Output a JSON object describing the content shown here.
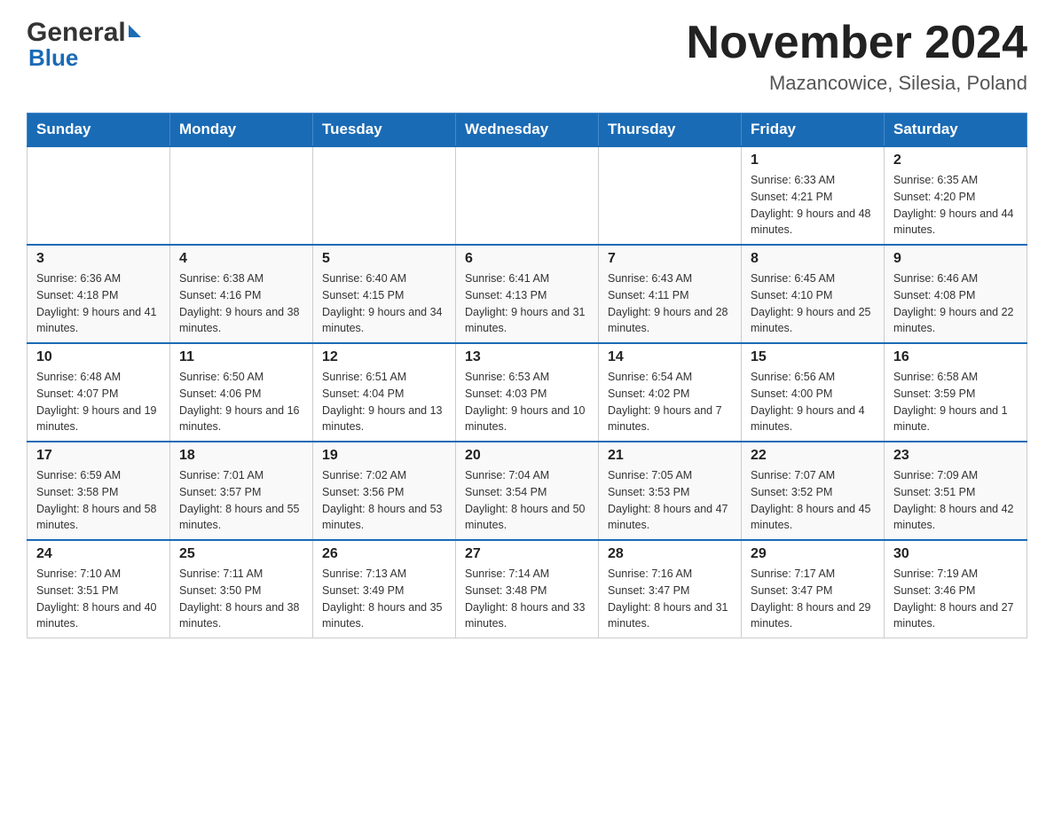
{
  "logo": {
    "general": "General",
    "blue": "Blue"
  },
  "header": {
    "month": "November 2024",
    "location": "Mazancowice, Silesia, Poland"
  },
  "weekdays": [
    "Sunday",
    "Monday",
    "Tuesday",
    "Wednesday",
    "Thursday",
    "Friday",
    "Saturday"
  ],
  "weeks": [
    [
      {
        "day": "",
        "sunrise": "",
        "sunset": "",
        "daylight": ""
      },
      {
        "day": "",
        "sunrise": "",
        "sunset": "",
        "daylight": ""
      },
      {
        "day": "",
        "sunrise": "",
        "sunset": "",
        "daylight": ""
      },
      {
        "day": "",
        "sunrise": "",
        "sunset": "",
        "daylight": ""
      },
      {
        "day": "",
        "sunrise": "",
        "sunset": "",
        "daylight": ""
      },
      {
        "day": "1",
        "sunrise": "Sunrise: 6:33 AM",
        "sunset": "Sunset: 4:21 PM",
        "daylight": "Daylight: 9 hours and 48 minutes."
      },
      {
        "day": "2",
        "sunrise": "Sunrise: 6:35 AM",
        "sunset": "Sunset: 4:20 PM",
        "daylight": "Daylight: 9 hours and 44 minutes."
      }
    ],
    [
      {
        "day": "3",
        "sunrise": "Sunrise: 6:36 AM",
        "sunset": "Sunset: 4:18 PM",
        "daylight": "Daylight: 9 hours and 41 minutes."
      },
      {
        "day": "4",
        "sunrise": "Sunrise: 6:38 AM",
        "sunset": "Sunset: 4:16 PM",
        "daylight": "Daylight: 9 hours and 38 minutes."
      },
      {
        "day": "5",
        "sunrise": "Sunrise: 6:40 AM",
        "sunset": "Sunset: 4:15 PM",
        "daylight": "Daylight: 9 hours and 34 minutes."
      },
      {
        "day": "6",
        "sunrise": "Sunrise: 6:41 AM",
        "sunset": "Sunset: 4:13 PM",
        "daylight": "Daylight: 9 hours and 31 minutes."
      },
      {
        "day": "7",
        "sunrise": "Sunrise: 6:43 AM",
        "sunset": "Sunset: 4:11 PM",
        "daylight": "Daylight: 9 hours and 28 minutes."
      },
      {
        "day": "8",
        "sunrise": "Sunrise: 6:45 AM",
        "sunset": "Sunset: 4:10 PM",
        "daylight": "Daylight: 9 hours and 25 minutes."
      },
      {
        "day": "9",
        "sunrise": "Sunrise: 6:46 AM",
        "sunset": "Sunset: 4:08 PM",
        "daylight": "Daylight: 9 hours and 22 minutes."
      }
    ],
    [
      {
        "day": "10",
        "sunrise": "Sunrise: 6:48 AM",
        "sunset": "Sunset: 4:07 PM",
        "daylight": "Daylight: 9 hours and 19 minutes."
      },
      {
        "day": "11",
        "sunrise": "Sunrise: 6:50 AM",
        "sunset": "Sunset: 4:06 PM",
        "daylight": "Daylight: 9 hours and 16 minutes."
      },
      {
        "day": "12",
        "sunrise": "Sunrise: 6:51 AM",
        "sunset": "Sunset: 4:04 PM",
        "daylight": "Daylight: 9 hours and 13 minutes."
      },
      {
        "day": "13",
        "sunrise": "Sunrise: 6:53 AM",
        "sunset": "Sunset: 4:03 PM",
        "daylight": "Daylight: 9 hours and 10 minutes."
      },
      {
        "day": "14",
        "sunrise": "Sunrise: 6:54 AM",
        "sunset": "Sunset: 4:02 PM",
        "daylight": "Daylight: 9 hours and 7 minutes."
      },
      {
        "day": "15",
        "sunrise": "Sunrise: 6:56 AM",
        "sunset": "Sunset: 4:00 PM",
        "daylight": "Daylight: 9 hours and 4 minutes."
      },
      {
        "day": "16",
        "sunrise": "Sunrise: 6:58 AM",
        "sunset": "Sunset: 3:59 PM",
        "daylight": "Daylight: 9 hours and 1 minute."
      }
    ],
    [
      {
        "day": "17",
        "sunrise": "Sunrise: 6:59 AM",
        "sunset": "Sunset: 3:58 PM",
        "daylight": "Daylight: 8 hours and 58 minutes."
      },
      {
        "day": "18",
        "sunrise": "Sunrise: 7:01 AM",
        "sunset": "Sunset: 3:57 PM",
        "daylight": "Daylight: 8 hours and 55 minutes."
      },
      {
        "day": "19",
        "sunrise": "Sunrise: 7:02 AM",
        "sunset": "Sunset: 3:56 PM",
        "daylight": "Daylight: 8 hours and 53 minutes."
      },
      {
        "day": "20",
        "sunrise": "Sunrise: 7:04 AM",
        "sunset": "Sunset: 3:54 PM",
        "daylight": "Daylight: 8 hours and 50 minutes."
      },
      {
        "day": "21",
        "sunrise": "Sunrise: 7:05 AM",
        "sunset": "Sunset: 3:53 PM",
        "daylight": "Daylight: 8 hours and 47 minutes."
      },
      {
        "day": "22",
        "sunrise": "Sunrise: 7:07 AM",
        "sunset": "Sunset: 3:52 PM",
        "daylight": "Daylight: 8 hours and 45 minutes."
      },
      {
        "day": "23",
        "sunrise": "Sunrise: 7:09 AM",
        "sunset": "Sunset: 3:51 PM",
        "daylight": "Daylight: 8 hours and 42 minutes."
      }
    ],
    [
      {
        "day": "24",
        "sunrise": "Sunrise: 7:10 AM",
        "sunset": "Sunset: 3:51 PM",
        "daylight": "Daylight: 8 hours and 40 minutes."
      },
      {
        "day": "25",
        "sunrise": "Sunrise: 7:11 AM",
        "sunset": "Sunset: 3:50 PM",
        "daylight": "Daylight: 8 hours and 38 minutes."
      },
      {
        "day": "26",
        "sunrise": "Sunrise: 7:13 AM",
        "sunset": "Sunset: 3:49 PM",
        "daylight": "Daylight: 8 hours and 35 minutes."
      },
      {
        "day": "27",
        "sunrise": "Sunrise: 7:14 AM",
        "sunset": "Sunset: 3:48 PM",
        "daylight": "Daylight: 8 hours and 33 minutes."
      },
      {
        "day": "28",
        "sunrise": "Sunrise: 7:16 AM",
        "sunset": "Sunset: 3:47 PM",
        "daylight": "Daylight: 8 hours and 31 minutes."
      },
      {
        "day": "29",
        "sunrise": "Sunrise: 7:17 AM",
        "sunset": "Sunset: 3:47 PM",
        "daylight": "Daylight: 8 hours and 29 minutes."
      },
      {
        "day": "30",
        "sunrise": "Sunrise: 7:19 AM",
        "sunset": "Sunset: 3:46 PM",
        "daylight": "Daylight: 8 hours and 27 minutes."
      }
    ]
  ]
}
